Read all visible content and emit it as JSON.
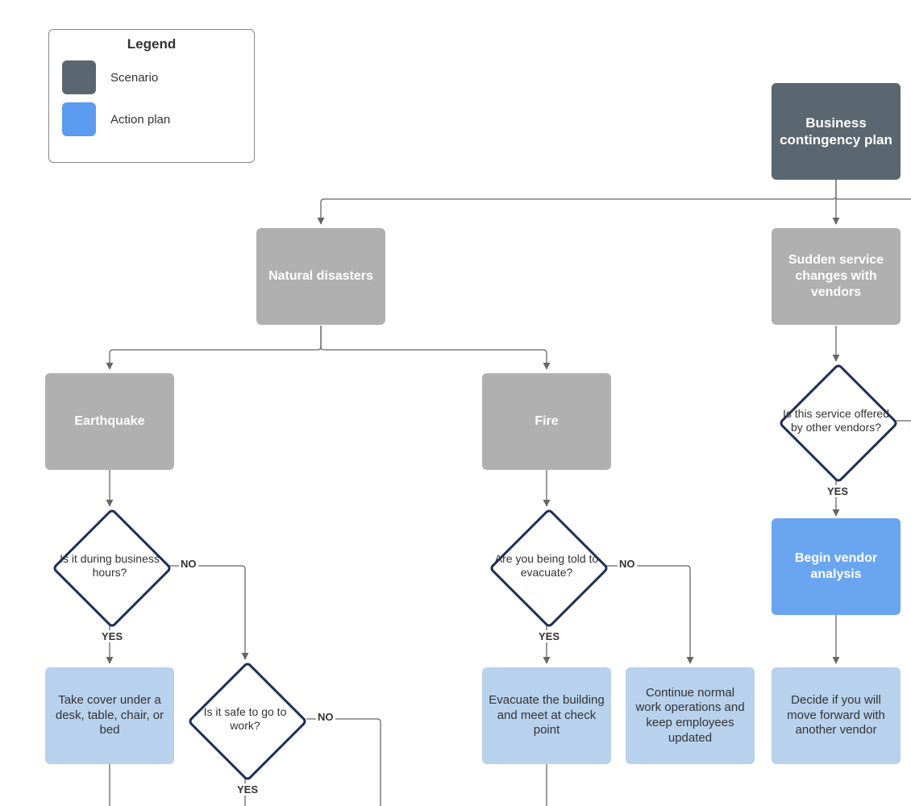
{
  "colors": {
    "scenario_root": "#5b6770",
    "scenario": "#b0b0b0",
    "action_strong": "#6aa6f0",
    "action": "#b8d1ed",
    "diamond_border": "#1d2f55",
    "line": "#666"
  },
  "legend": {
    "title": "Legend",
    "items": [
      {
        "label": "Scenario",
        "color": "#5b6770"
      },
      {
        "label": "Action plan",
        "color": "#5b9bf0"
      }
    ]
  },
  "nodes": {
    "root": "Business contingency plan",
    "natural": "Natural disasters",
    "vendors": "Sudden service changes with vendors",
    "earthquake": "Earthquake",
    "fire": "Fire",
    "q_biz_hours": "Is it during business hours?",
    "q_evacuate": "Are you being told to evacuate?",
    "q_vendor_off": "Is this service offered by other vendors?",
    "q_safe_work": "Is it safe to go to work?",
    "a_take_cover": "Take cover under a desk, table, chair, or bed",
    "a_evacuate": "Evacuate the building and meet at check point",
    "a_continue": "Continue normal work operations and keep employees updated",
    "a_begin": "Begin vendor analysis",
    "a_decide": "Decide if you will move forward with another vendor"
  },
  "edge_labels": {
    "yes": "YES",
    "no": "NO"
  }
}
